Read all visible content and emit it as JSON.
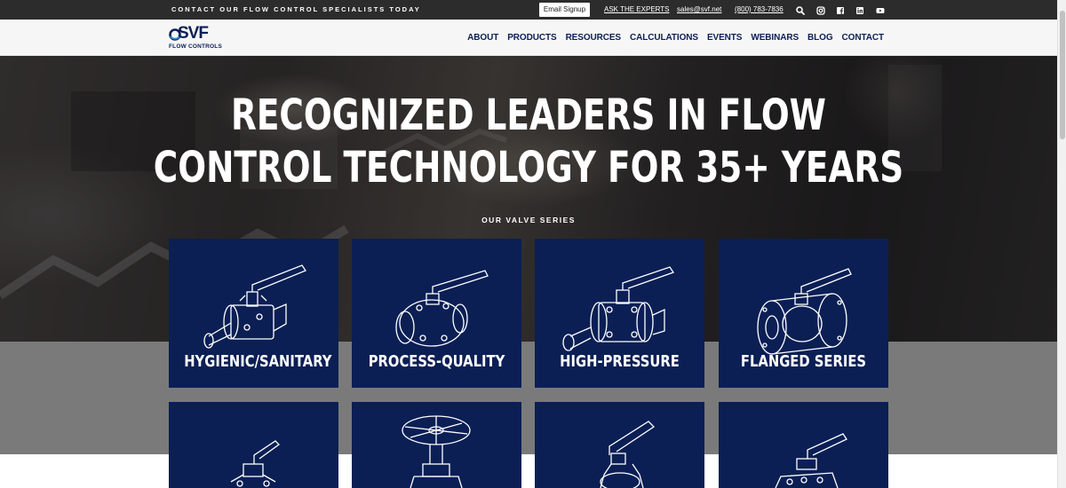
{
  "topbar": {
    "tagline": "CONTACT OUR FLOW CONTROL SPECIALISTS TODAY",
    "email_signup": "Email Signup",
    "ask_experts": "ASK THE EXPERTS",
    "email": "sales@svf.net",
    "phone": "(800) 783-7836",
    "icons": [
      "search-icon",
      "instagram-icon",
      "facebook-icon",
      "linkedin-icon",
      "youtube-icon"
    ]
  },
  "logo": {
    "text": "SVF",
    "subtitle": "FLOW CONTROLS"
  },
  "nav": {
    "items": [
      {
        "label": "ABOUT"
      },
      {
        "label": "PRODUCTS"
      },
      {
        "label": "RESOURCES"
      },
      {
        "label": "CALCULATIONS"
      },
      {
        "label": "EVENTS"
      },
      {
        "label": "WEBINARS"
      },
      {
        "label": "BLOG"
      },
      {
        "label": "CONTACT"
      }
    ]
  },
  "hero": {
    "title_line1": "RECOGNIZED LEADERS IN FLOW",
    "title_line2": "CONTROL TECHNOLOGY FOR 35+ YEARS",
    "series_label": "OUR VALVE SERIES"
  },
  "valve_series": {
    "row1": [
      {
        "label": "HYGIENIC/SANITARY"
      },
      {
        "label": "PROCESS-QUALITY"
      },
      {
        "label": "HIGH-PRESSURE"
      },
      {
        "label": "FLANGED SERIES"
      }
    ],
    "row2": [
      {
        "label": ""
      },
      {
        "label": ""
      },
      {
        "label": ""
      },
      {
        "label": ""
      }
    ]
  },
  "colors": {
    "navy": "#0b1f55",
    "topbar": "#2c2c2c",
    "nav_bg": "#f6f6f6",
    "gray_band": "#7a7a7a"
  }
}
